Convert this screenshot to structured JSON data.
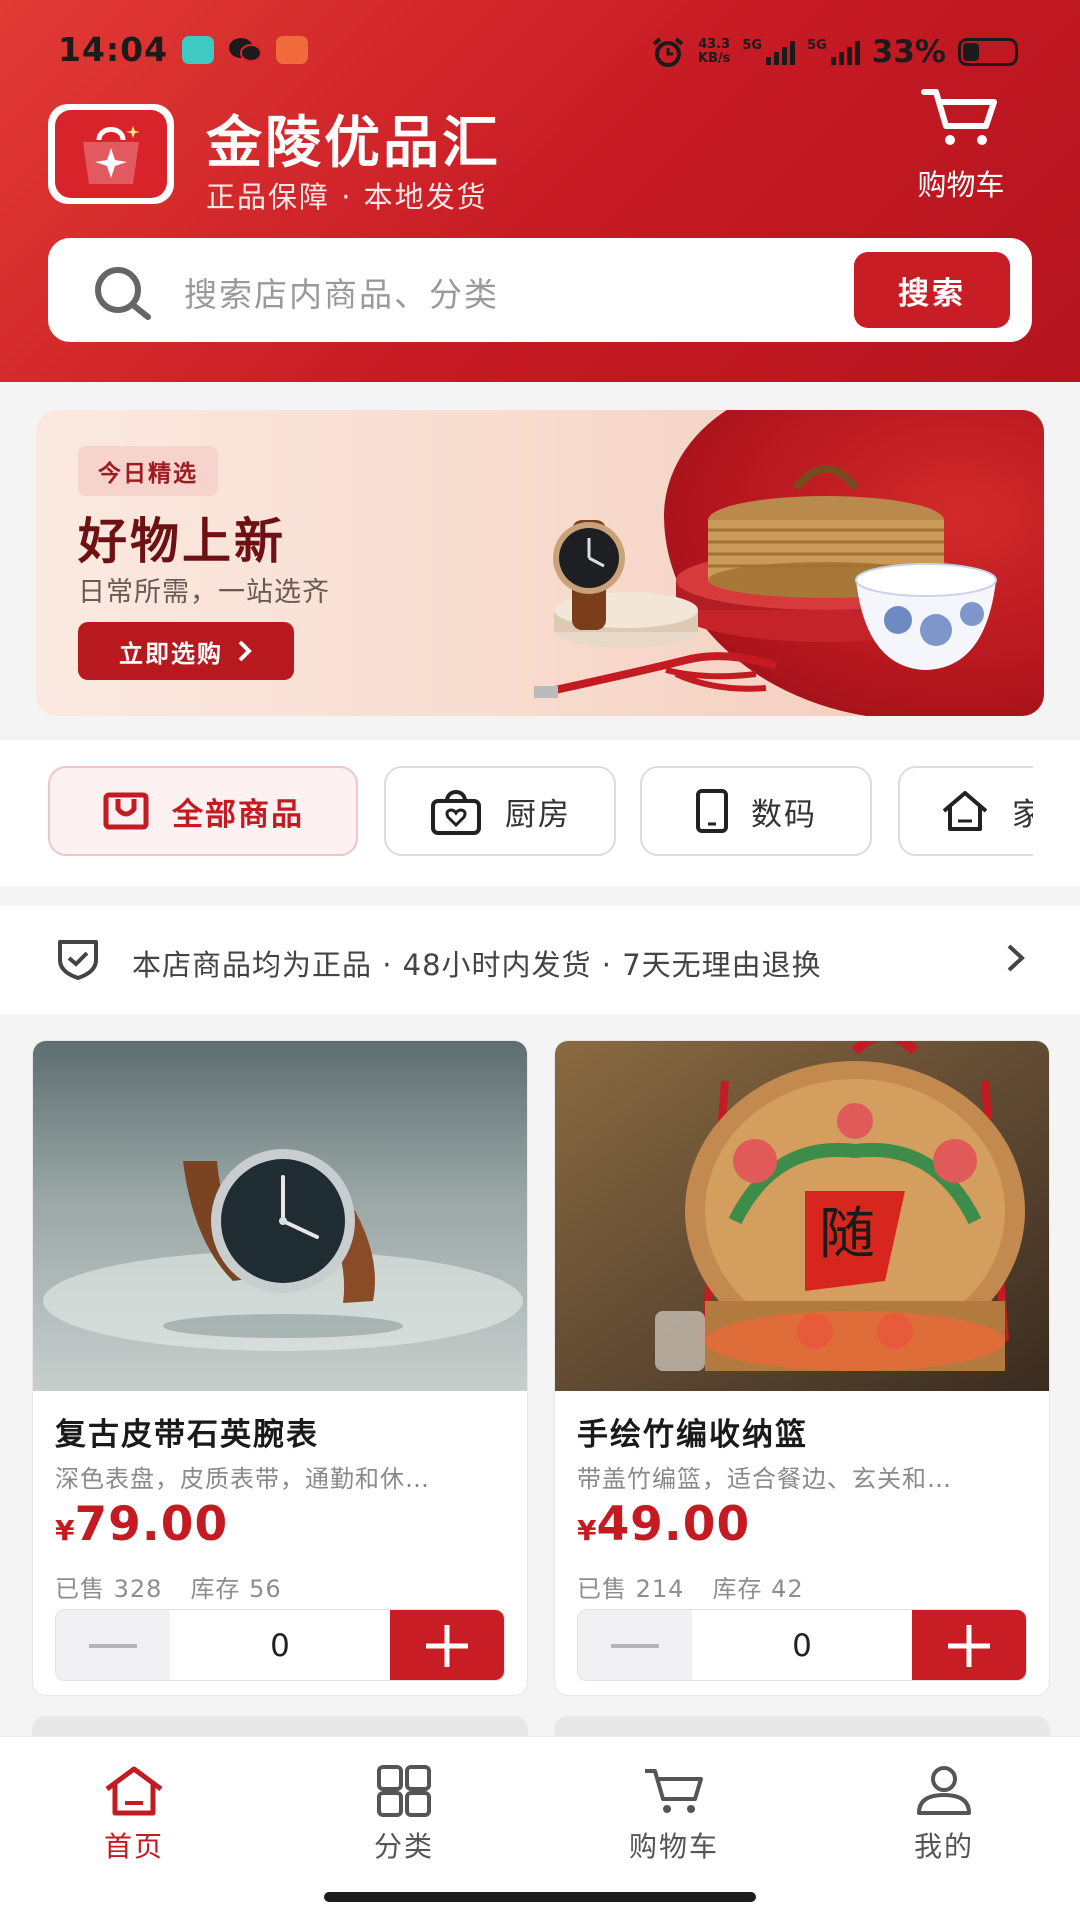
{
  "status_bar": {
    "time": "14:04",
    "net_speed": "43.3",
    "net_unit": "KB/s",
    "sim1": "5G",
    "sim2": "5G",
    "battery": "33%"
  },
  "header": {
    "brand_name": "金陵优品汇",
    "brand_tagline": "正品保障 · 本地发货",
    "cart_label": "购物车"
  },
  "search": {
    "placeholder": "搜索店内商品、分类",
    "button_label": "搜索"
  },
  "banner": {
    "tag": "今日精选",
    "title": "好物上新",
    "subtitle": "日常所需，一站选齐",
    "cta": "立即选购"
  },
  "categories": [
    {
      "label": "全部商品",
      "icon": "bag-icon",
      "active": true
    },
    {
      "label": "厨房",
      "icon": "shopping-bag-heart-icon",
      "active": false
    },
    {
      "label": "数码",
      "icon": "phone-icon",
      "active": false
    },
    {
      "label": "家",
      "icon": "home-icon",
      "active": false
    }
  ],
  "guarantee": {
    "text": "本店商品均为正品 · 48小时内发货 · 7天无理由退换"
  },
  "products": [
    {
      "name": "复古皮带石英腕表",
      "desc": "深色表盘，皮质表带，通勤和休…",
      "currency": "¥",
      "price": "79.00",
      "sold": "已售 328",
      "stock": "库存 56",
      "quantity": "0"
    },
    {
      "name": "手绘竹编收纳篮",
      "desc": "带盖竹编篮，适合餐边、玄关和…",
      "currency": "¥",
      "price": "49.00",
      "sold": "已售 214",
      "stock": "库存 42",
      "quantity": "0"
    }
  ],
  "bottom_nav": [
    {
      "label": "首页",
      "icon": "home-icon",
      "active": true
    },
    {
      "label": "分类",
      "icon": "grid-icon",
      "active": false
    },
    {
      "label": "购物车",
      "icon": "cart-icon",
      "active": false
    },
    {
      "label": "我的",
      "icon": "user-icon",
      "active": false
    }
  ],
  "colors": {
    "brand_red": "#c81d25",
    "header_gradient_start": "#e23a35",
    "header_gradient_end": "#b4141f"
  }
}
